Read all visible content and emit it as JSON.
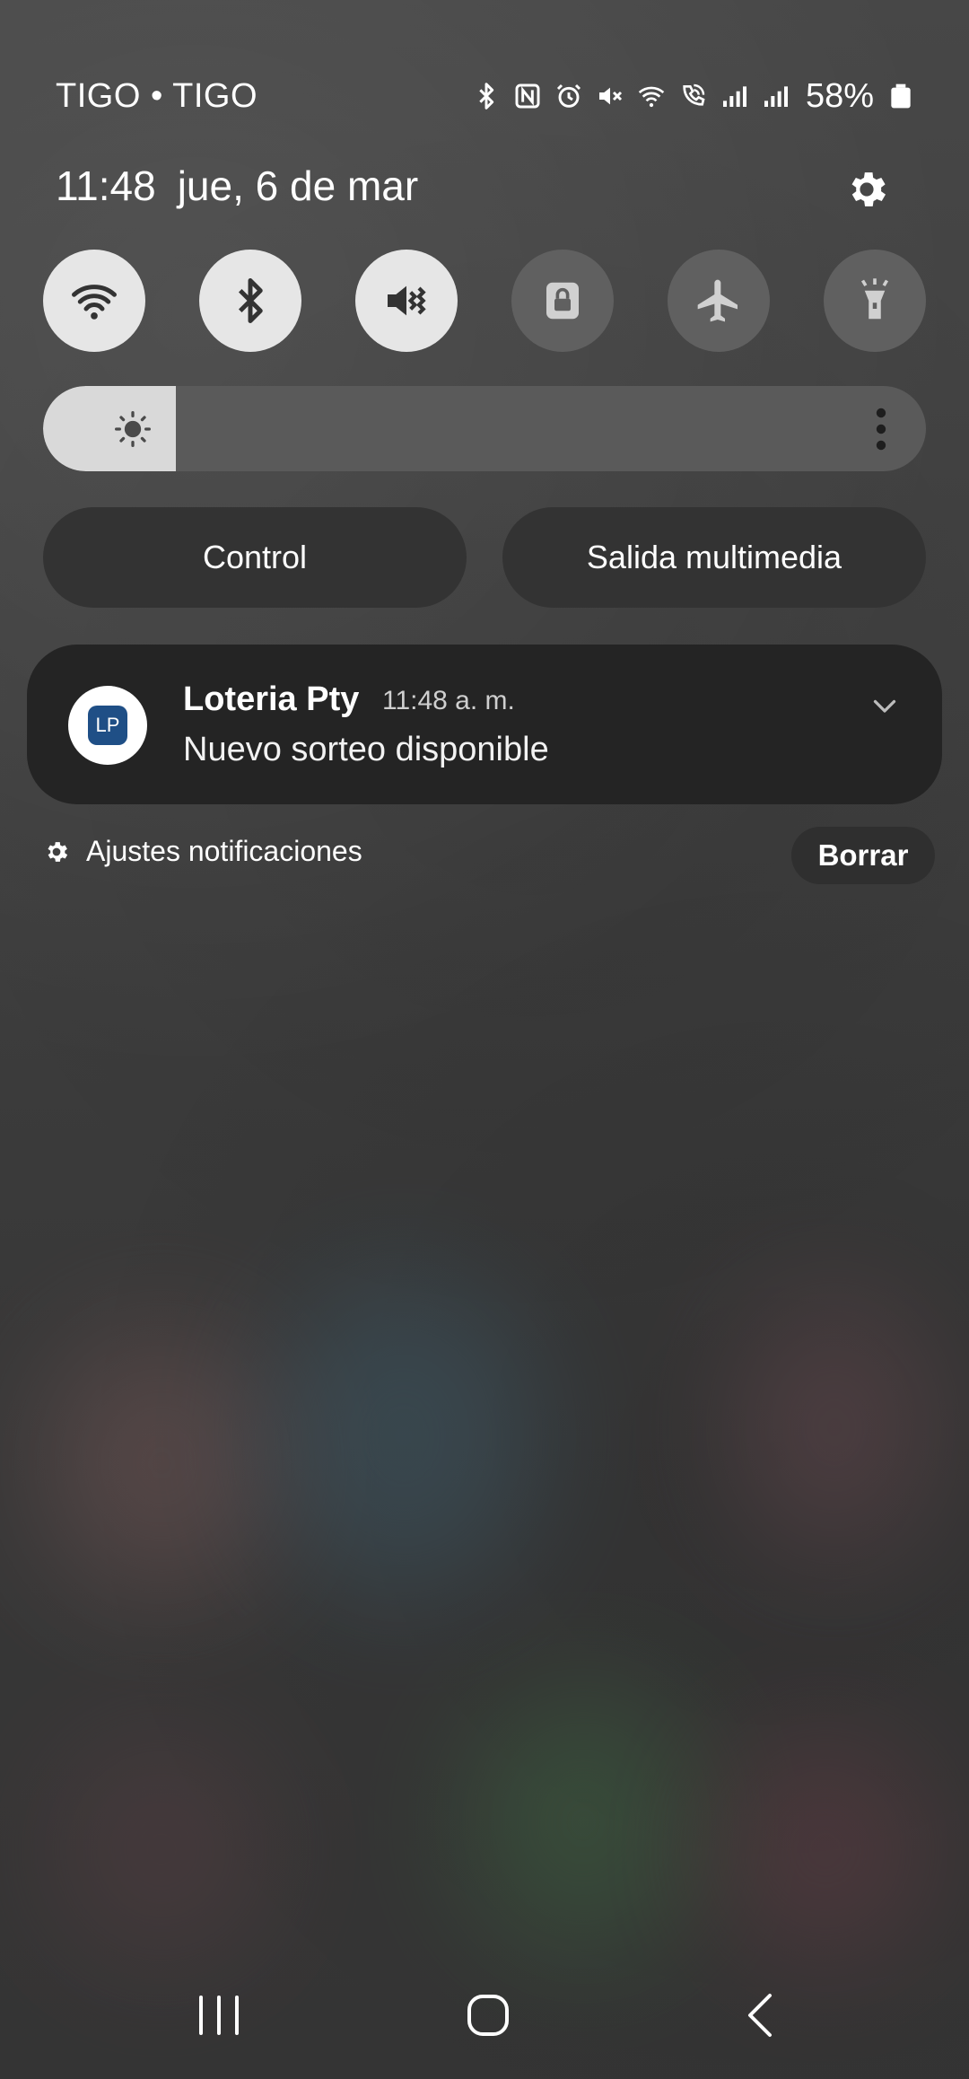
{
  "status_bar": {
    "carriers": "TIGO • TIGO",
    "battery_percent": "58%",
    "icons": [
      "bluetooth-icon",
      "nfc-icon",
      "alarm-icon",
      "mute-icon",
      "wifi-icon",
      "wifi-calling-icon",
      "signal-icon",
      "signal-icon",
      "battery-icon"
    ]
  },
  "header": {
    "time": "11:48",
    "date": "jue, 6 de mar"
  },
  "quick_settings": [
    {
      "name": "wifi",
      "icon": "wifi-icon",
      "on": true
    },
    {
      "name": "bluetooth",
      "icon": "bluetooth-icon",
      "on": true
    },
    {
      "name": "sound",
      "icon": "vibrate-icon",
      "on": true
    },
    {
      "name": "screen-lock",
      "icon": "lock-icon",
      "on": false
    },
    {
      "name": "airplane",
      "icon": "airplane-icon",
      "on": false
    },
    {
      "name": "flashlight",
      "icon": "flashlight-icon",
      "on": false
    }
  ],
  "brightness": {
    "level": 0.15
  },
  "pills": {
    "control": "Control",
    "media_output": "Salida multimedia"
  },
  "notification": {
    "app_name": "Loteria Pty",
    "time": "11:48 a. m.",
    "body": "Nuevo sorteo disponible",
    "icon_text": "LP",
    "icon_color": "#1f4f86"
  },
  "notification_actions": {
    "settings_label": "Ajustes notificaciones",
    "clear_label": "Borrar"
  },
  "colors": {
    "tile_on": "#e6e6e6",
    "tile_off": "#606060",
    "notification_bg": "#242424"
  }
}
